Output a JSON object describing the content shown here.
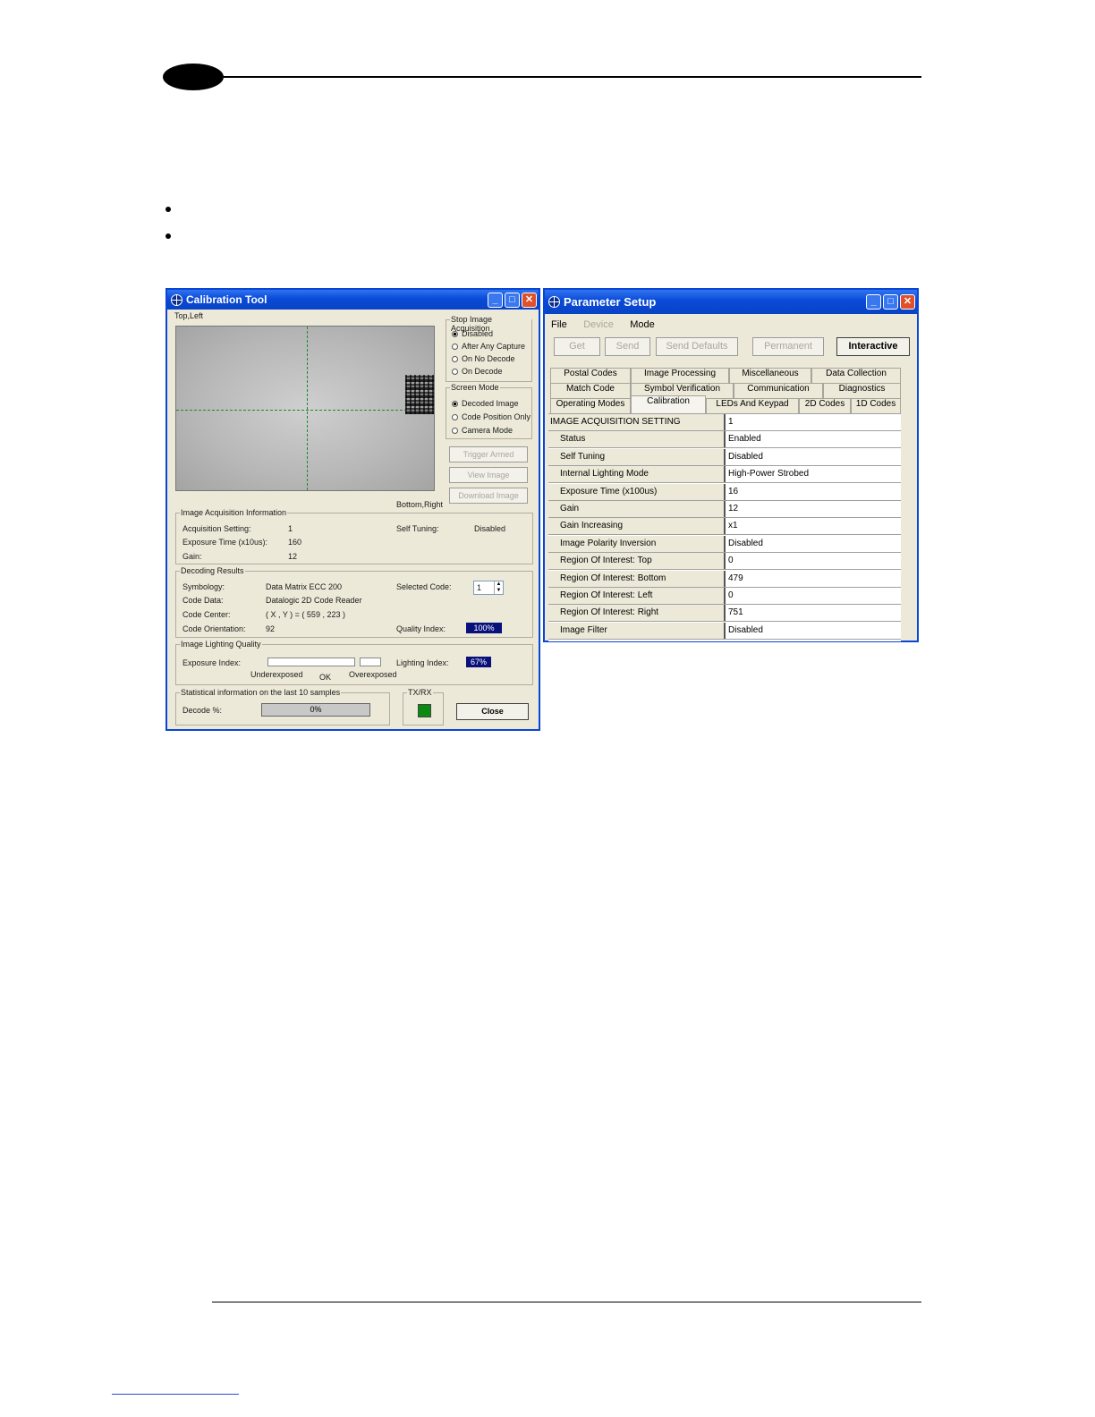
{
  "calibration_tool": {
    "title": "Calibration Tool",
    "top_left_label": "Top,Left",
    "bottom_right_label": "Bottom,Right",
    "stop_acquisition": {
      "label": "Stop Image Acquisition",
      "options": [
        "Disabled",
        "After Any Capture",
        "On No Decode",
        "On Decode"
      ]
    },
    "screen_mode": {
      "label": "Screen Mode",
      "options": [
        "Decoded Image",
        "Code Position Only",
        "Camera Mode"
      ]
    },
    "buttons": {
      "trigger": "Trigger Armed",
      "view": "View Image",
      "download": "Download Image",
      "close": "Close"
    },
    "acq_info": {
      "label": "Image Acquisition Information",
      "setting_label": "Acquisition Setting:",
      "setting_value": "1",
      "self_tuning_label": "Self Tuning:",
      "self_tuning_value": "Disabled",
      "exposure_label": "Exposure Time (x10us):",
      "exposure_value": "160",
      "gain_label": "Gain:",
      "gain_value": "12"
    },
    "decoding": {
      "label": "Decoding Results",
      "symbology_label": "Symbology:",
      "symbology_value": "Data Matrix ECC 200",
      "code_data_label": "Code Data:",
      "code_data_value": "Datalogic 2D Code Reader",
      "center_label": "Code Center:",
      "center_value": "( X , Y ) = ( 559 , 223 )",
      "orientation_label": "Code Orientation:",
      "orientation_value": "92",
      "selected_label": "Selected Code:",
      "selected_value": "1",
      "quality_label": "Quality Index:",
      "quality_value": "100%"
    },
    "lighting": {
      "label": "Image Lighting Quality",
      "exposure_index_label": "Exposure Index:",
      "under": "Underexposed",
      "ok": "OK",
      "over": "Overexposed",
      "lighting_index_label": "Lighting Index:",
      "lighting_index_value": "67%"
    },
    "stats": {
      "label": "Statistical information on the last 10 samples",
      "decode_label": "Decode %:",
      "decode_value": "0%"
    },
    "txrx_label": "TX/RX",
    "txrx_color": "#0b8a12"
  },
  "parameter_setup": {
    "title": "Parameter Setup",
    "menu": [
      "File",
      "Device",
      "Mode"
    ],
    "toolbar": [
      "Get",
      "Send",
      "Send Defaults",
      "Permanent",
      "Interactive"
    ],
    "tabs_row1": [
      "Postal Codes",
      "Image Processing",
      "Miscellaneous",
      "Data Collection"
    ],
    "tabs_row2": [
      "Match Code",
      "Symbol Verification",
      "Communication",
      "Diagnostics"
    ],
    "tabs_row3": [
      "Operating Modes",
      "Calibration",
      "LEDs And Keypad",
      "2D Codes",
      "1D Codes"
    ],
    "grid": [
      {
        "k": "IMAGE ACQUISITION SETTING",
        "v": "1"
      },
      {
        "k": "Status",
        "v": "Enabled"
      },
      {
        "k": "Self Tuning",
        "v": "Disabled"
      },
      {
        "k": "Internal Lighting Mode",
        "v": "High-Power Strobed"
      },
      {
        "k": "Exposure Time (x100us)",
        "v": "16"
      },
      {
        "k": "Gain",
        "v": "12"
      },
      {
        "k": "Gain Increasing",
        "v": "x1"
      },
      {
        "k": "Image Polarity Inversion",
        "v": "Disabled"
      },
      {
        "k": "Region Of Interest: Top",
        "v": "0"
      },
      {
        "k": "Region Of Interest: Bottom",
        "v": "479"
      },
      {
        "k": "Region Of Interest: Left",
        "v": "0"
      },
      {
        "k": "Region Of Interest: Right",
        "v": "751"
      },
      {
        "k": "Image Filter",
        "v": "Disabled"
      }
    ]
  }
}
